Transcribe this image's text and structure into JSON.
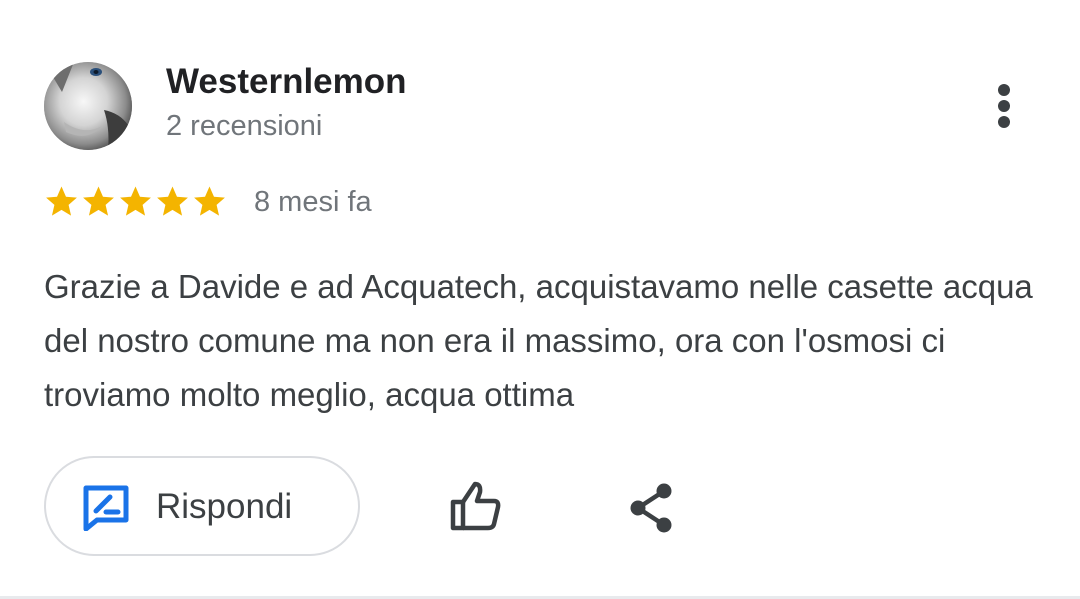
{
  "review": {
    "author_name": "Westernlemon",
    "author_meta": "2 recensioni",
    "rating": 5,
    "rating_max": 5,
    "date": "8 mesi fa",
    "text": "Grazie a Davide e ad Acquatech, acquistavamo nelle casette acqua del nostro comune ma non era il massimo, ora con l'osmosi ci troviamo molto meglio, acqua ottima"
  },
  "actions": {
    "reply_label": "Rispondi"
  },
  "icons": {
    "more": "more-vert-icon",
    "star": "star-icon",
    "reply": "reply-edit-icon",
    "like": "thumb-up-icon",
    "share": "share-icon"
  },
  "colors": {
    "star": "#F4B400",
    "reply_icon": "#1A73E8",
    "primary_text": "#202124",
    "secondary_text": "#70757A",
    "body_text": "#3C4043",
    "button_border": "#DADCE0"
  }
}
